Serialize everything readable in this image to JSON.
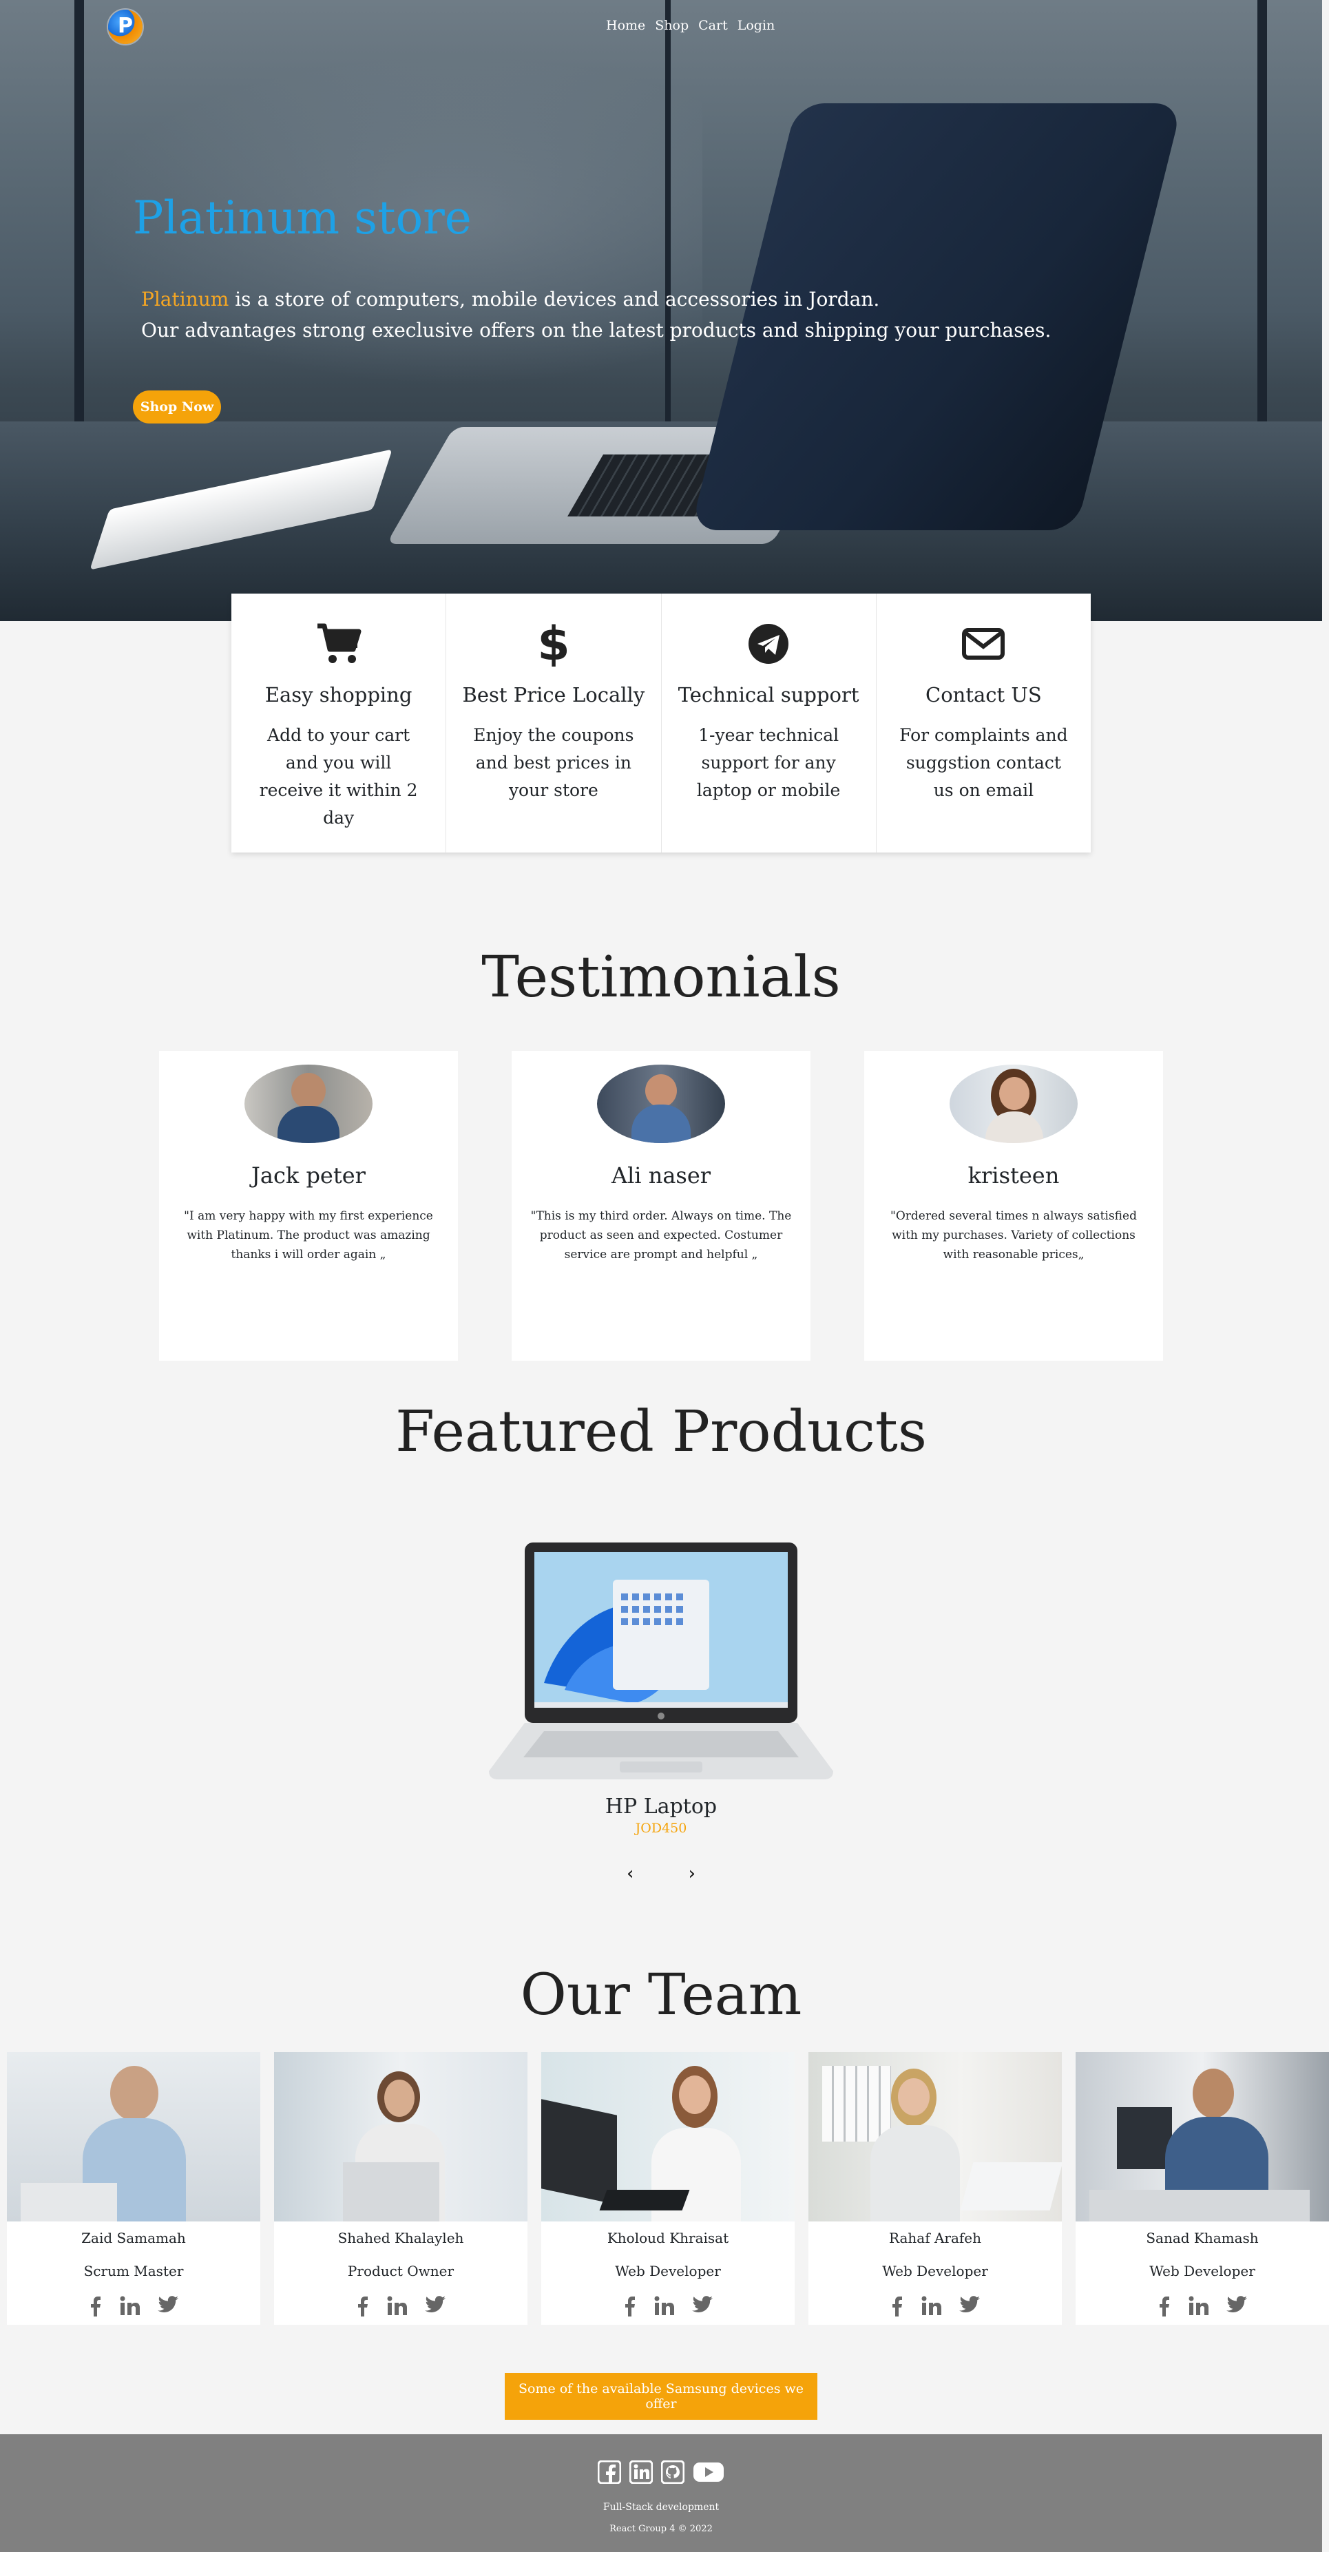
{
  "nav": {
    "logo_letter": "P",
    "items": [
      "Home",
      "Shop",
      "Cart",
      "Login"
    ]
  },
  "hero": {
    "title": "Platinum store",
    "brand": "Platinum",
    "line1_rest": " is a store of computers, mobile devices and accessories in Jordan.",
    "line2": "Our advantages strong execlusive offers on the latest products and shipping your purchases.",
    "button": "Shop Now"
  },
  "features": [
    {
      "icon": "cart-icon",
      "title": "Easy shopping",
      "text": "Add to your cart and you will receive it within 2 day"
    },
    {
      "icon": "dollar-icon",
      "title": "Best Price Locally",
      "text": "Enjoy the coupons and best prices in your store"
    },
    {
      "icon": "telegram-icon",
      "title": "Technical support",
      "text": "1-year technical support for any laptop or mobile"
    },
    {
      "icon": "envelope-icon",
      "title": "Contact US",
      "text": "For complaints and suggstion contact us on email"
    }
  ],
  "testimonials": {
    "title": "Testimonials",
    "items": [
      {
        "name": "Jack peter",
        "text": "\"I am very happy with my first experience with Platinum. The product was amazing thanks i will order again „"
      },
      {
        "name": "Ali naser",
        "text": "\"This is my third order. Always on time. The product as seen and expected. Costumer service are prompt and helpful „"
      },
      {
        "name": "kristeen",
        "text": "\"Ordered several times n always satisfied with my purchases. Variety of collections with reasonable prices„"
      }
    ]
  },
  "featured": {
    "title": "Featured Products",
    "product_name": "HP Laptop",
    "product_price": "JOD450",
    "prev": "‹",
    "next": "›"
  },
  "team": {
    "title": "Our Team",
    "members": [
      {
        "name": "Zaid Samamah",
        "role": "Scrum Master"
      },
      {
        "name": "Shahed Khalayleh",
        "role": "Product Owner"
      },
      {
        "name": "Kholoud Khraisat",
        "role": "Web Developer"
      },
      {
        "name": "Rahaf Arafeh",
        "role": "Web Developer"
      },
      {
        "name": "Sanad Khamash",
        "role": "Web Developer"
      }
    ]
  },
  "cta": "Some of the available Samsung devices we offer",
  "footer": {
    "line1": "Full-Stack development",
    "line2": "React Group 4 © 2022"
  },
  "colors": {
    "accent": "#f5a30a",
    "title_blue": "#1ea1e6",
    "footer_bg": "#808080"
  }
}
